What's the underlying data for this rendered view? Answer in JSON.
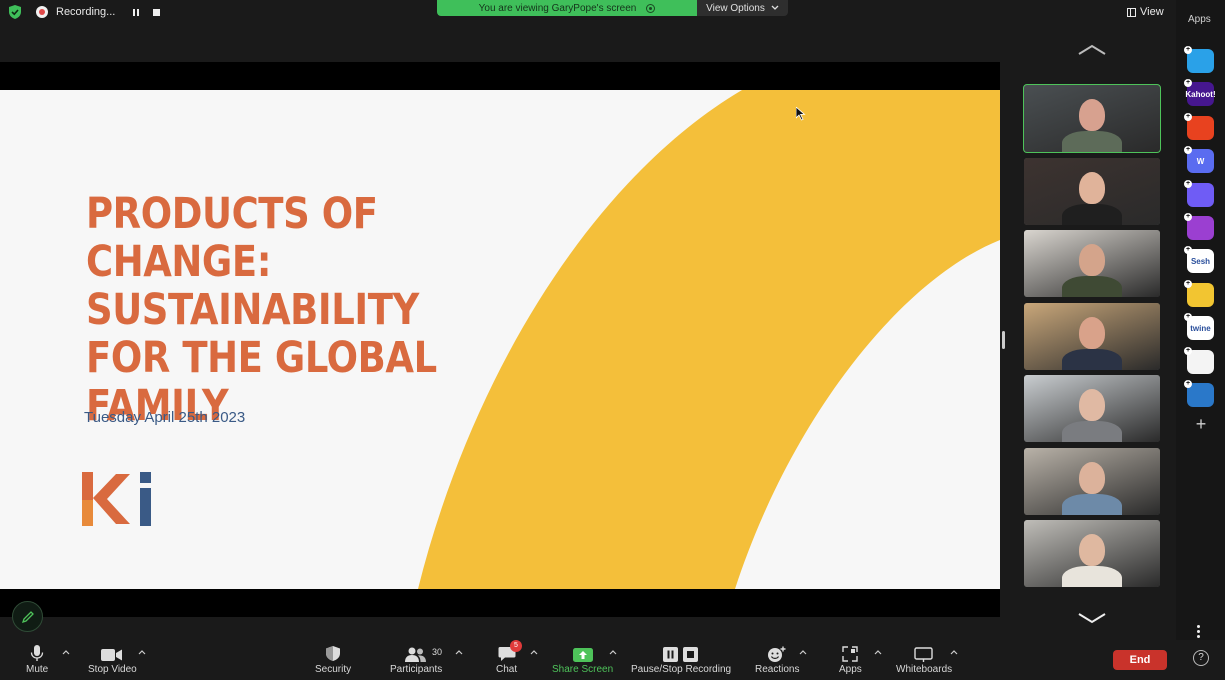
{
  "topbar": {
    "recording_label": "Recording...",
    "viewing_banner": "You are viewing GaryPope's screen",
    "view_options": "View Options",
    "view_label": "View"
  },
  "slide": {
    "title": "PRODUCTS OF CHANGE: SUSTAINABILITY FOR THE GLOBAL FAMILY",
    "date": "Tuesday April 25th 2023",
    "logo_text": "Ki",
    "colors": {
      "title": "#d96a3f",
      "arc": "#f4bf3a",
      "date": "#3a5a86",
      "bg": "#f7f7f7"
    }
  },
  "gallery": {
    "tiles": [
      {
        "id": "participant-1",
        "active": true,
        "bg": "#4a4f52",
        "skin": "#d7a18f",
        "shirt": "#5d6b59"
      },
      {
        "id": "participant-2",
        "active": false,
        "bg": "#3d3330",
        "skin": "#e0b39a",
        "shirt": "#1f1f1f"
      },
      {
        "id": "participant-3",
        "active": false,
        "bg": "#d9d5cf",
        "skin": "#d4a48b",
        "shirt": "#3f4a34"
      },
      {
        "id": "participant-4",
        "active": false,
        "bg": "#c9a77a",
        "skin": "#d9a28a",
        "shirt": "#2b3345"
      },
      {
        "id": "participant-5",
        "active": false,
        "bg": "#c9cdd0",
        "skin": "#e0b9a3",
        "shirt": "#7a7c80"
      },
      {
        "id": "participant-6",
        "active": false,
        "bg": "#b9b2a8",
        "skin": "#dcb29b",
        "shirt": "#6d8aa8"
      },
      {
        "id": "participant-7",
        "active": false,
        "bg": "#bfbdb8",
        "skin": "#dfb8a0",
        "shirt": "#e8e4dc"
      }
    ]
  },
  "apps": {
    "title": "Apps",
    "items": [
      {
        "name": "app-1",
        "label": "",
        "color": "#2aa1e8"
      },
      {
        "name": "kahoot",
        "label": "Kahoot!",
        "color": "#46178f"
      },
      {
        "name": "app-3",
        "label": "",
        "color": "#e8421f"
      },
      {
        "name": "app-4",
        "label": "W",
        "color": "#5a6cf0"
      },
      {
        "name": "app-5",
        "label": "",
        "color": "#6f5cf5"
      },
      {
        "name": "app-6",
        "label": "",
        "color": "#9b3fd1"
      },
      {
        "name": "sesh",
        "label": "Sesh",
        "color": "#ffffff"
      },
      {
        "name": "app-8",
        "label": "",
        "color": "#f2c531"
      },
      {
        "name": "twine",
        "label": "twine",
        "color": "#ffffff"
      },
      {
        "name": "app-10",
        "label": "",
        "color": "#f4f4f4"
      },
      {
        "name": "app-11",
        "label": "",
        "color": "#2a78c9"
      }
    ]
  },
  "toolbar": {
    "mute": "Mute",
    "stop_video": "Stop Video",
    "security": "Security",
    "participants": "Participants",
    "participants_count": "30",
    "chat": "Chat",
    "chat_badge": "5",
    "share_screen": "Share Screen",
    "pause_stop_recording": "Pause/Stop Recording",
    "reactions": "Reactions",
    "apps": "Apps",
    "whiteboards": "Whiteboards",
    "end": "End"
  }
}
